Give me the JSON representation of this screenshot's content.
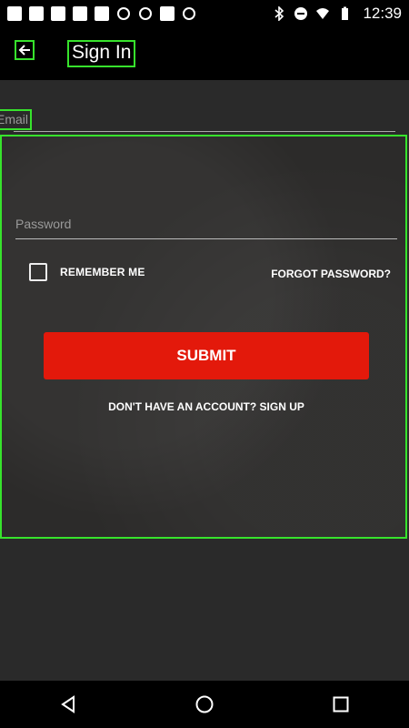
{
  "status_bar": {
    "time": "12:39",
    "left_icons": [
      "notification-icon",
      "notification-icon",
      "notification-icon",
      "notification-icon",
      "notification-icon",
      "app-icon",
      "app-icon",
      "square-icon",
      "app-icon"
    ],
    "right_icons": [
      "bluetooth-icon",
      "do-not-disturb-icon",
      "wifi-icon",
      "battery-icon"
    ]
  },
  "appbar": {
    "title": "Sign In"
  },
  "form": {
    "email_label": "Email",
    "password_placeholder": "Password",
    "remember_me": "REMEMBER ME",
    "forgot_password": "FORGOT PASSWORD?",
    "submit": "SUBMIT",
    "signup": "DON'T HAVE AN ACCOUNT? SIGN UP"
  },
  "colors": {
    "accent_red": "#e3190b",
    "highlight_green": "#37e32c",
    "background": "#262626"
  }
}
